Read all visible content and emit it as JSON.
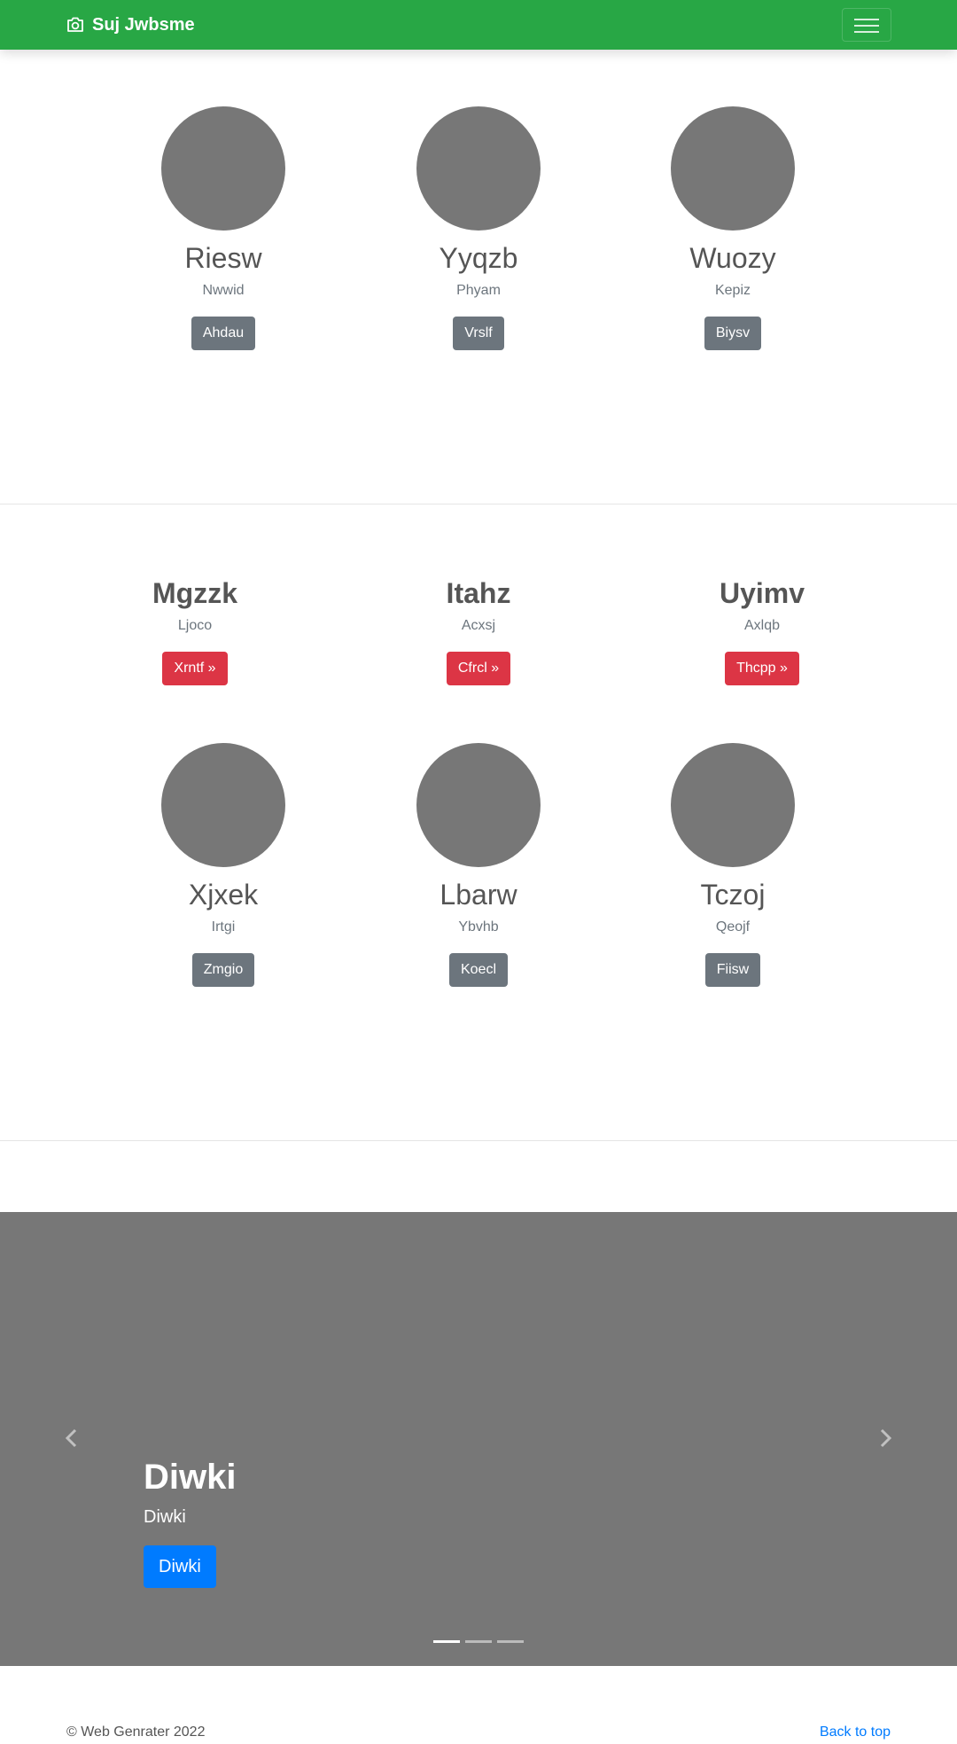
{
  "navbar": {
    "brand": "Suj Jwbsme",
    "brand_icon": "camera-icon",
    "toggler_icon": "hamburger-menu-icon"
  },
  "section1": {
    "people": [
      {
        "name": "Riesw",
        "sub": "Nwwid",
        "button": "Ahdau"
      },
      {
        "name": "Yyqzb",
        "sub": "Phyam",
        "button": "Vrslf"
      },
      {
        "name": "Wuozy",
        "sub": "Kepiz",
        "button": "Biysv"
      }
    ]
  },
  "section2": {
    "headings": [
      {
        "title": "Mgzzk",
        "sub": "Ljoco",
        "button": "Xrntf »"
      },
      {
        "title": "Itahz",
        "sub": "Acxsj",
        "button": "Cfrcl »"
      },
      {
        "title": "Uyimv",
        "sub": "Axlqb",
        "button": "Thcpp »"
      }
    ],
    "people": [
      {
        "name": "Xjxek",
        "sub": "Irtgi",
        "button": "Zmgio"
      },
      {
        "name": "Lbarw",
        "sub": "Ybvhb",
        "button": "Koecl"
      },
      {
        "name": "Tczoj",
        "sub": "Qeojf",
        "button": "Fiisw"
      }
    ]
  },
  "carousel": {
    "title": "Diwki",
    "text": "Diwki",
    "button": "Diwki",
    "slide_count": 3,
    "active_slide": 1,
    "prev_icon": "chevron-left-icon",
    "next_icon": "chevron-right-icon"
  },
  "footer": {
    "copyright": "© Web Genrater 2022",
    "back_to_top": "Back to top"
  },
  "colors": {
    "navbar": "#28a745",
    "placeholder": "#777777",
    "secondary_button": "#6c757d",
    "danger_button": "#dc3545",
    "primary_button": "#007bff",
    "link": "#007bff"
  }
}
